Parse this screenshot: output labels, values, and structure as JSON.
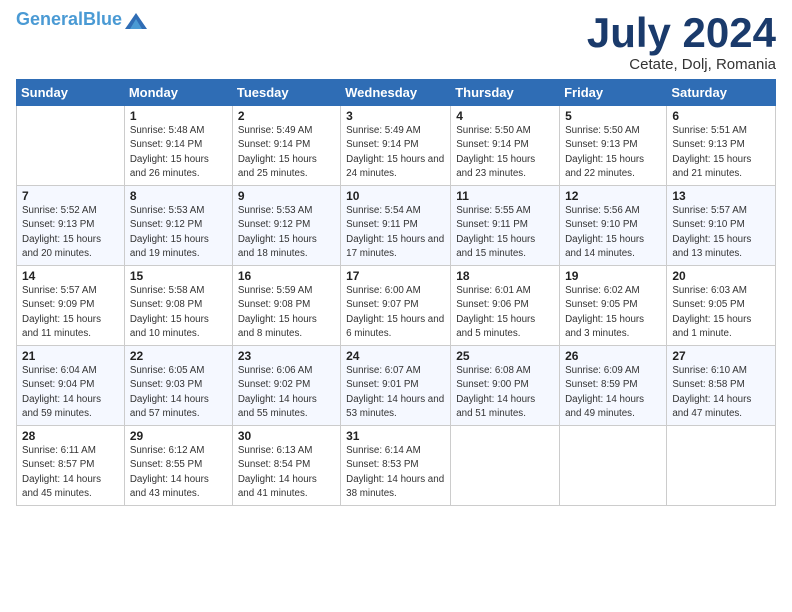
{
  "header": {
    "logo_line1a": "General",
    "logo_line1b": "Blue",
    "month": "July 2024",
    "location": "Cetate, Dolj, Romania"
  },
  "days": [
    "Sunday",
    "Monday",
    "Tuesday",
    "Wednesday",
    "Thursday",
    "Friday",
    "Saturday"
  ],
  "weeks": [
    [
      {
        "date": "",
        "sunrise": "",
        "sunset": "",
        "daylight": ""
      },
      {
        "date": "1",
        "sunrise": "Sunrise: 5:48 AM",
        "sunset": "Sunset: 9:14 PM",
        "daylight": "Daylight: 15 hours and 26 minutes."
      },
      {
        "date": "2",
        "sunrise": "Sunrise: 5:49 AM",
        "sunset": "Sunset: 9:14 PM",
        "daylight": "Daylight: 15 hours and 25 minutes."
      },
      {
        "date": "3",
        "sunrise": "Sunrise: 5:49 AM",
        "sunset": "Sunset: 9:14 PM",
        "daylight": "Daylight: 15 hours and 24 minutes."
      },
      {
        "date": "4",
        "sunrise": "Sunrise: 5:50 AM",
        "sunset": "Sunset: 9:14 PM",
        "daylight": "Daylight: 15 hours and 23 minutes."
      },
      {
        "date": "5",
        "sunrise": "Sunrise: 5:50 AM",
        "sunset": "Sunset: 9:13 PM",
        "daylight": "Daylight: 15 hours and 22 minutes."
      },
      {
        "date": "6",
        "sunrise": "Sunrise: 5:51 AM",
        "sunset": "Sunset: 9:13 PM",
        "daylight": "Daylight: 15 hours and 21 minutes."
      }
    ],
    [
      {
        "date": "7",
        "sunrise": "Sunrise: 5:52 AM",
        "sunset": "Sunset: 9:13 PM",
        "daylight": "Daylight: 15 hours and 20 minutes."
      },
      {
        "date": "8",
        "sunrise": "Sunrise: 5:53 AM",
        "sunset": "Sunset: 9:12 PM",
        "daylight": "Daylight: 15 hours and 19 minutes."
      },
      {
        "date": "9",
        "sunrise": "Sunrise: 5:53 AM",
        "sunset": "Sunset: 9:12 PM",
        "daylight": "Daylight: 15 hours and 18 minutes."
      },
      {
        "date": "10",
        "sunrise": "Sunrise: 5:54 AM",
        "sunset": "Sunset: 9:11 PM",
        "daylight": "Daylight: 15 hours and 17 minutes."
      },
      {
        "date": "11",
        "sunrise": "Sunrise: 5:55 AM",
        "sunset": "Sunset: 9:11 PM",
        "daylight": "Daylight: 15 hours and 15 minutes."
      },
      {
        "date": "12",
        "sunrise": "Sunrise: 5:56 AM",
        "sunset": "Sunset: 9:10 PM",
        "daylight": "Daylight: 15 hours and 14 minutes."
      },
      {
        "date": "13",
        "sunrise": "Sunrise: 5:57 AM",
        "sunset": "Sunset: 9:10 PM",
        "daylight": "Daylight: 15 hours and 13 minutes."
      }
    ],
    [
      {
        "date": "14",
        "sunrise": "Sunrise: 5:57 AM",
        "sunset": "Sunset: 9:09 PM",
        "daylight": "Daylight: 15 hours and 11 minutes."
      },
      {
        "date": "15",
        "sunrise": "Sunrise: 5:58 AM",
        "sunset": "Sunset: 9:08 PM",
        "daylight": "Daylight: 15 hours and 10 minutes."
      },
      {
        "date": "16",
        "sunrise": "Sunrise: 5:59 AM",
        "sunset": "Sunset: 9:08 PM",
        "daylight": "Daylight: 15 hours and 8 minutes."
      },
      {
        "date": "17",
        "sunrise": "Sunrise: 6:00 AM",
        "sunset": "Sunset: 9:07 PM",
        "daylight": "Daylight: 15 hours and 6 minutes."
      },
      {
        "date": "18",
        "sunrise": "Sunrise: 6:01 AM",
        "sunset": "Sunset: 9:06 PM",
        "daylight": "Daylight: 15 hours and 5 minutes."
      },
      {
        "date": "19",
        "sunrise": "Sunrise: 6:02 AM",
        "sunset": "Sunset: 9:05 PM",
        "daylight": "Daylight: 15 hours and 3 minutes."
      },
      {
        "date": "20",
        "sunrise": "Sunrise: 6:03 AM",
        "sunset": "Sunset: 9:05 PM",
        "daylight": "Daylight: 15 hours and 1 minute."
      }
    ],
    [
      {
        "date": "21",
        "sunrise": "Sunrise: 6:04 AM",
        "sunset": "Sunset: 9:04 PM",
        "daylight": "Daylight: 14 hours and 59 minutes."
      },
      {
        "date": "22",
        "sunrise": "Sunrise: 6:05 AM",
        "sunset": "Sunset: 9:03 PM",
        "daylight": "Daylight: 14 hours and 57 minutes."
      },
      {
        "date": "23",
        "sunrise": "Sunrise: 6:06 AM",
        "sunset": "Sunset: 9:02 PM",
        "daylight": "Daylight: 14 hours and 55 minutes."
      },
      {
        "date": "24",
        "sunrise": "Sunrise: 6:07 AM",
        "sunset": "Sunset: 9:01 PM",
        "daylight": "Daylight: 14 hours and 53 minutes."
      },
      {
        "date": "25",
        "sunrise": "Sunrise: 6:08 AM",
        "sunset": "Sunset: 9:00 PM",
        "daylight": "Daylight: 14 hours and 51 minutes."
      },
      {
        "date": "26",
        "sunrise": "Sunrise: 6:09 AM",
        "sunset": "Sunset: 8:59 PM",
        "daylight": "Daylight: 14 hours and 49 minutes."
      },
      {
        "date": "27",
        "sunrise": "Sunrise: 6:10 AM",
        "sunset": "Sunset: 8:58 PM",
        "daylight": "Daylight: 14 hours and 47 minutes."
      }
    ],
    [
      {
        "date": "28",
        "sunrise": "Sunrise: 6:11 AM",
        "sunset": "Sunset: 8:57 PM",
        "daylight": "Daylight: 14 hours and 45 minutes."
      },
      {
        "date": "29",
        "sunrise": "Sunrise: 6:12 AM",
        "sunset": "Sunset: 8:55 PM",
        "daylight": "Daylight: 14 hours and 43 minutes."
      },
      {
        "date": "30",
        "sunrise": "Sunrise: 6:13 AM",
        "sunset": "Sunset: 8:54 PM",
        "daylight": "Daylight: 14 hours and 41 minutes."
      },
      {
        "date": "31",
        "sunrise": "Sunrise: 6:14 AM",
        "sunset": "Sunset: 8:53 PM",
        "daylight": "Daylight: 14 hours and 38 minutes."
      },
      {
        "date": "",
        "sunrise": "",
        "sunset": "",
        "daylight": ""
      },
      {
        "date": "",
        "sunrise": "",
        "sunset": "",
        "daylight": ""
      },
      {
        "date": "",
        "sunrise": "",
        "sunset": "",
        "daylight": ""
      }
    ]
  ]
}
